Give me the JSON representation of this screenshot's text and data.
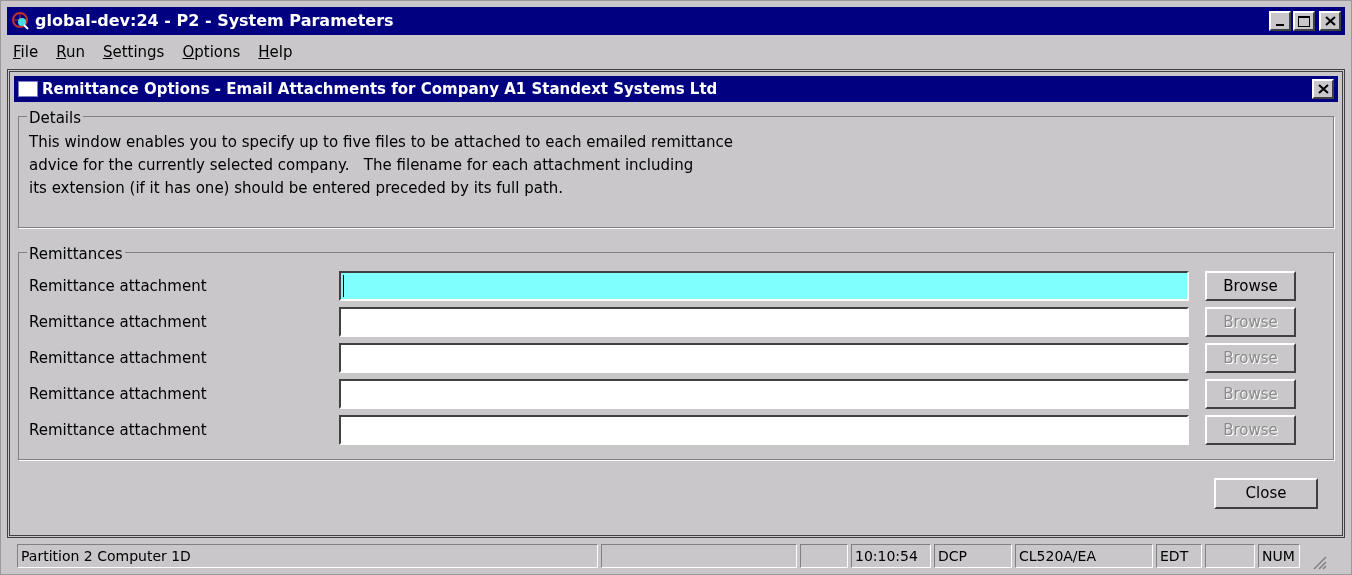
{
  "window": {
    "title": "global-dev:24 - P2 - System Parameters"
  },
  "menu": [
    "File",
    "Run",
    "Settings",
    "Options",
    "Help"
  ],
  "dialog": {
    "title": "Remittance Options - Email Attachments for Company A1 Standext Systems Ltd",
    "details": {
      "legend": "Details",
      "lines": [
        "This window enables you to specify up to five files to be attached to each emailed remittance",
        "advice for the currently selected company.   The filename for each attachment including",
        "its extension (if it has one) should be entered preceded by its full path."
      ]
    },
    "remittances": {
      "legend": "Remittances",
      "rows": [
        {
          "label": "Remittance attachment",
          "focused": true,
          "button": "Browse",
          "disabled": false
        },
        {
          "label": "Remittance attachment",
          "focused": false,
          "button": "Browse",
          "disabled": true
        },
        {
          "label": "Remittance attachment",
          "focused": false,
          "button": "Browse",
          "disabled": true
        },
        {
          "label": "Remittance attachment",
          "focused": false,
          "button": "Browse",
          "disabled": true
        },
        {
          "label": "Remittance attachment",
          "focused": false,
          "button": "Browse",
          "disabled": true
        }
      ]
    },
    "close_button": "Close"
  },
  "status_bar": {
    "message": "Partition 2 Computer 1D",
    "time": "10:10:54",
    "mode": "DCP",
    "program": "CL520A/EA",
    "edit": "EDT",
    "num_lock": "NUM"
  }
}
